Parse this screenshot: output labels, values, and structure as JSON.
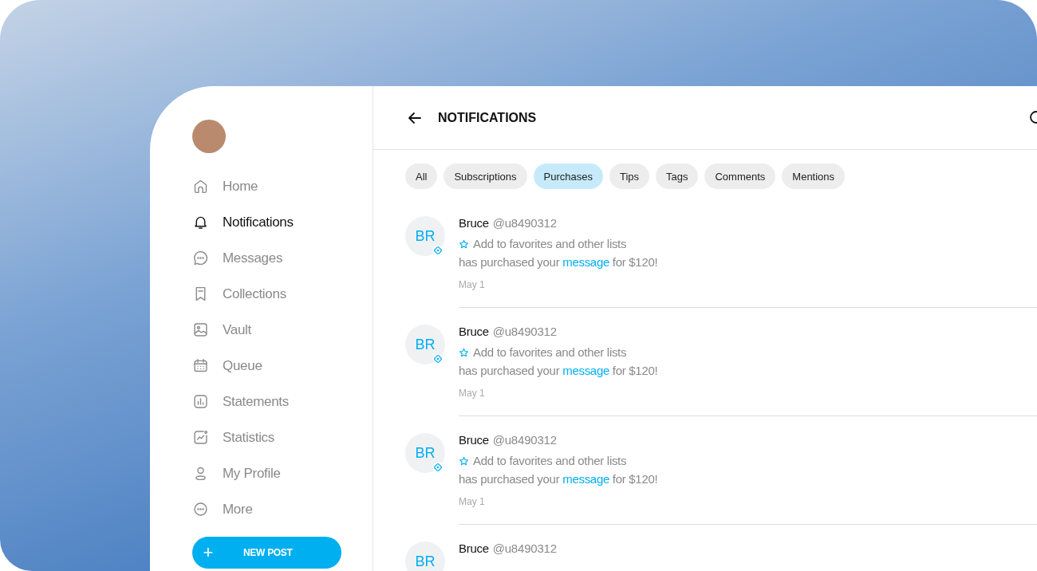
{
  "sidebar": {
    "items": [
      {
        "label": "Home",
        "selected": false
      },
      {
        "label": "Notifications",
        "selected": true
      },
      {
        "label": "Messages",
        "selected": false
      },
      {
        "label": "Collections",
        "selected": false
      },
      {
        "label": "Vault",
        "selected": false
      },
      {
        "label": "Queue",
        "selected": false
      },
      {
        "label": "Statements",
        "selected": false
      },
      {
        "label": "Statistics",
        "selected": false
      },
      {
        "label": "My Profile",
        "selected": false
      },
      {
        "label": "More",
        "selected": false
      }
    ],
    "button": {
      "icon": "+",
      "label": "NEW POST"
    }
  },
  "header": {
    "title": "NOTIFICATIONS"
  },
  "filters": [
    {
      "label": "All",
      "selected": false
    },
    {
      "label": "Subscriptions",
      "selected": false
    },
    {
      "label": "Purchases",
      "selected": true
    },
    {
      "label": "Tips",
      "selected": false
    },
    {
      "label": "Tags",
      "selected": false
    },
    {
      "label": "Comments",
      "selected": false
    },
    {
      "label": "Mentions",
      "selected": false
    }
  ],
  "notifications": [
    {
      "initials": "BR",
      "name": "Bruce",
      "handle": "@u8490312",
      "favorite": "Add to favorites and other lists",
      "text_before": "has purchased your",
      "link": "message",
      "text_after": "for $120!",
      "date": "May 1"
    },
    {
      "initials": "BR",
      "name": "Bruce",
      "handle": "@u8490312",
      "favorite": "Add to favorites and other lists",
      "text_before": "has purchased your",
      "link": "message",
      "text_after": "for $120!",
      "date": "May 1"
    },
    {
      "initials": "BR",
      "name": "Bruce",
      "handle": "@u8490312",
      "favorite": "Add to favorites and other lists",
      "text_before": "has purchased your",
      "link": "message",
      "text_after": "for $120!",
      "date": "May 1"
    },
    {
      "initials": "BR",
      "name": "Bruce",
      "handle": "@u8490312"
    }
  ]
}
